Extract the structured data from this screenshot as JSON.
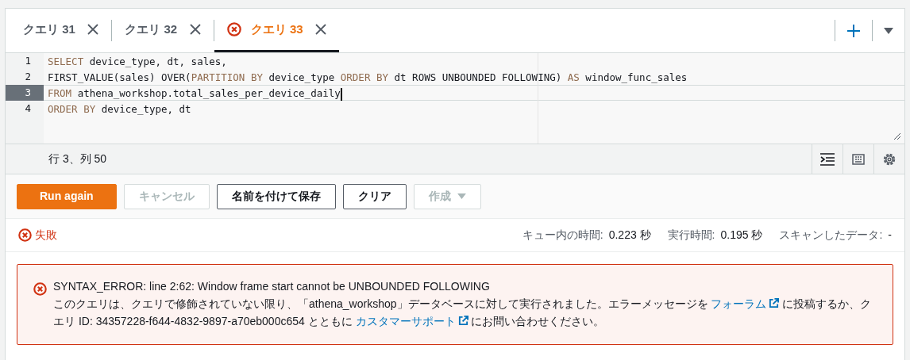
{
  "tabs": [
    {
      "label": "クエリ 31",
      "selected": false,
      "failed": false
    },
    {
      "label": "クエリ 32",
      "selected": false,
      "failed": false
    },
    {
      "label": "クエリ 33",
      "selected": true,
      "failed": true
    }
  ],
  "editor": {
    "lines": [
      {
        "number": "1",
        "current": false,
        "tokens": [
          {
            "kind": "keyword",
            "text": "SELECT"
          },
          {
            "kind": "plain",
            "text": " device_type, dt, sales,"
          }
        ]
      },
      {
        "number": "2",
        "current": false,
        "tokens": [
          {
            "kind": "plain",
            "text": "FIRST_VALUE(sales) OVER("
          },
          {
            "kind": "keyword",
            "text": "PARTITION BY"
          },
          {
            "kind": "plain",
            "text": " device_type "
          },
          {
            "kind": "keyword",
            "text": "ORDER BY"
          },
          {
            "kind": "plain",
            "text": " dt ROWS UNBOUNDED FOLLOWING) "
          },
          {
            "kind": "keyword",
            "text": "AS"
          },
          {
            "kind": "plain",
            "text": " window_func_sales"
          }
        ]
      },
      {
        "number": "3",
        "current": true,
        "tokens": [
          {
            "kind": "keyword",
            "text": "FROM"
          },
          {
            "kind": "plain",
            "text": " athena_workshop.total_sales_per_device_daily"
          }
        ]
      },
      {
        "number": "4",
        "current": false,
        "tokens": [
          {
            "kind": "keyword",
            "text": "ORDER BY"
          },
          {
            "kind": "plain",
            "text": " device_type, dt"
          }
        ]
      }
    ],
    "cursor_position": "行 3、列 50"
  },
  "buttons": [
    {
      "label": "Run again",
      "kind": "primary",
      "disabled": false,
      "dropdown": false
    },
    {
      "label": "キャンセル",
      "kind": "normal",
      "disabled": true,
      "dropdown": false
    },
    {
      "label": "名前を付けて保存",
      "kind": "normal",
      "disabled": false,
      "dropdown": false
    },
    {
      "label": "クリア",
      "kind": "normal",
      "disabled": false,
      "dropdown": false
    },
    {
      "label": "作成",
      "kind": "normal",
      "disabled": true,
      "dropdown": true
    }
  ],
  "status": {
    "label": "失敗",
    "stats": [
      {
        "label": "キュー内の時間:",
        "value": "0.223 秒"
      },
      {
        "label": "実行時間:",
        "value": "0.195 秒"
      },
      {
        "label": "スキャンしたデータ:",
        "value": "-"
      }
    ]
  },
  "error": {
    "title": "SYNTAX_ERROR: line 2:62: Window frame start cannot be UNBOUNDED FOLLOWING",
    "message": [
      {
        "kind": "text",
        "text": "このクエリは、クエリで修飾されていない限り、「athena_workshop」データベースに対して実行されました。エラーメッセージを "
      },
      {
        "kind": "link",
        "text": "フォーラム"
      },
      {
        "kind": "text",
        "text": " に投稿するか、クエリ ID: 34357228-f644-4832-9897-a70eb000c654 とともに "
      },
      {
        "kind": "link",
        "text": "カスタマーサポート"
      },
      {
        "kind": "text",
        "text": " にお問い合わせください。"
      }
    ]
  }
}
